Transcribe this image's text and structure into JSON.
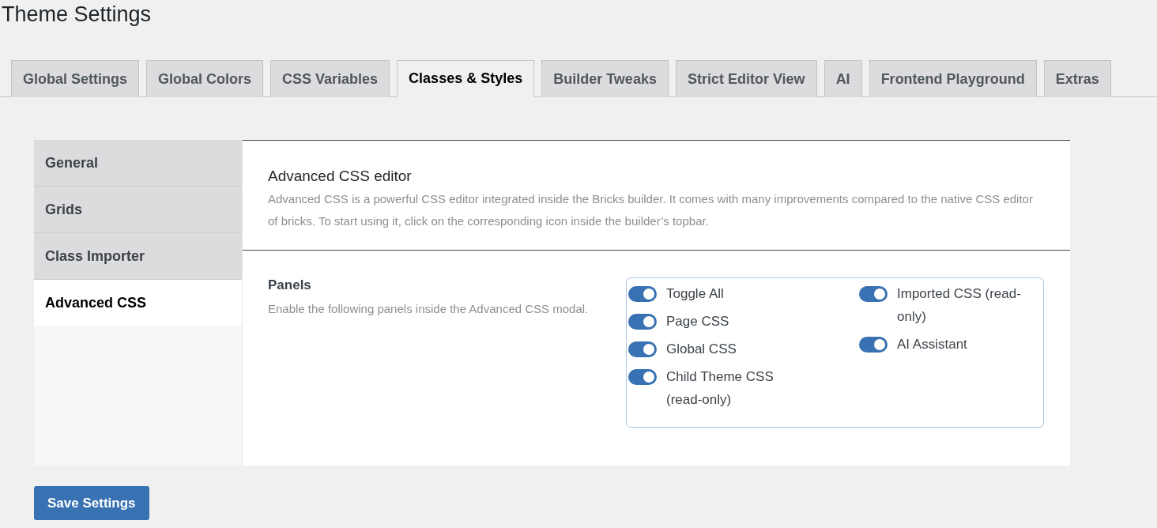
{
  "page_title": "Theme Settings",
  "tabs": [
    {
      "label": "Global Settings",
      "selected": false
    },
    {
      "label": "Global Colors",
      "selected": false
    },
    {
      "label": "CSS Variables",
      "selected": false
    },
    {
      "label": "Classes & Styles",
      "selected": true
    },
    {
      "label": "Builder Tweaks",
      "selected": false
    },
    {
      "label": "Strict Editor View",
      "selected": false
    },
    {
      "label": "AI",
      "selected": false
    },
    {
      "label": "Frontend Playground",
      "selected": false
    },
    {
      "label": "Extras",
      "selected": false
    }
  ],
  "sidebar": {
    "items": [
      {
        "label": "General",
        "selected": false
      },
      {
        "label": "Grids",
        "selected": false
      },
      {
        "label": "Class Importer",
        "selected": false
      },
      {
        "label": "Advanced CSS",
        "selected": true
      }
    ]
  },
  "section": {
    "heading": "Advanced CSS editor",
    "description": "Advanced CSS is a powerful CSS editor integrated inside the Bricks builder. It comes with many improvements compared to the native CSS editor of bricks. To start using it, click on the corresponding icon inside the builder’s topbar."
  },
  "panels": {
    "label": "Panels",
    "description": "Enable the following panels inside the Advanced CSS modal.",
    "toggle_columns": [
      [
        {
          "label": "Toggle All",
          "on": true
        },
        {
          "label": "Page CSS",
          "on": true
        },
        {
          "label": "Global CSS",
          "on": true
        },
        {
          "label": "Child Theme CSS (read-only)",
          "on": true
        }
      ],
      [
        {
          "label": "Imported CSS (read-only)",
          "on": true
        },
        {
          "label": "AI Assistant",
          "on": true
        }
      ]
    ]
  },
  "save_button": "Save Settings"
}
